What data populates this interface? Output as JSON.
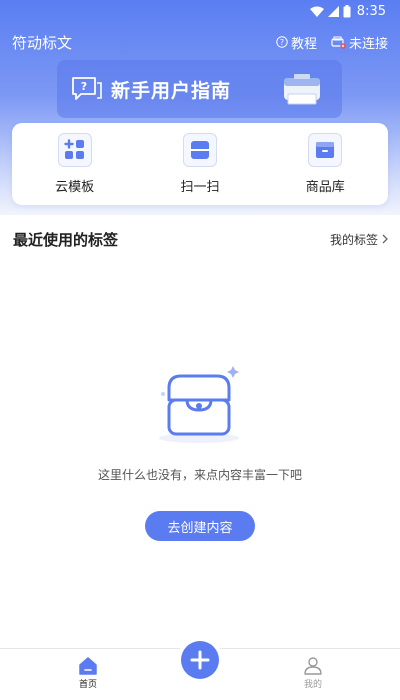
{
  "status_bar": {
    "time": "8:35"
  },
  "header": {
    "app_title": "符动标文",
    "tutorial_label": "教程",
    "connection_label": "未连接"
  },
  "banner": {
    "title": "新手用户指南",
    "bubble_mark": "?"
  },
  "quick_actions": [
    {
      "label": "云模板",
      "icon": "grid-plus-icon"
    },
    {
      "label": "扫一扫",
      "icon": "scan-icon"
    },
    {
      "label": "商品库",
      "icon": "product-box-icon"
    }
  ],
  "recent": {
    "title": "最近使用的标签",
    "my_tags_label": "我的标签"
  },
  "empty_state": {
    "message": "这里什么也没有，来点内容丰富一下吧",
    "button_label": "去创建内容"
  },
  "tabbar": {
    "home_label": "首页",
    "mine_label": "我的"
  },
  "colors": {
    "accent": "#5b7cf0",
    "header_gradient_top": "#5a7ef2"
  }
}
